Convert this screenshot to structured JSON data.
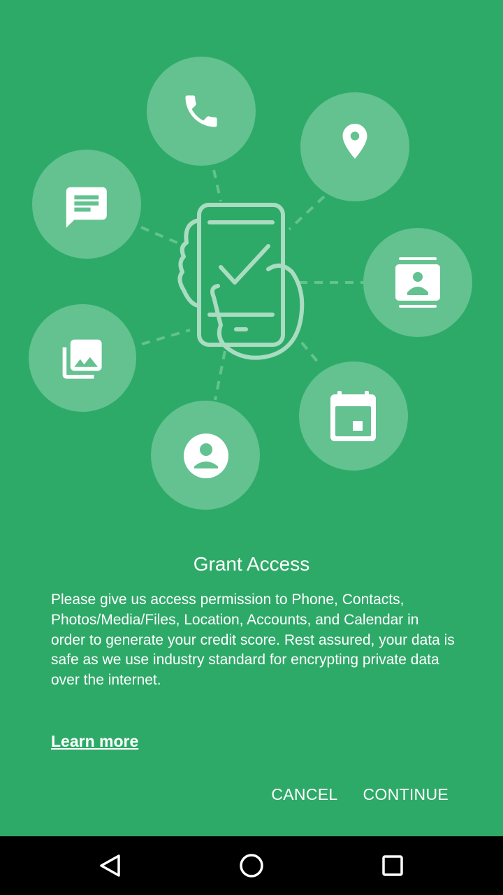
{
  "dialog": {
    "title": "Grant Access",
    "message": "Please give us access permission to Phone, Contacts, Photos/Media/Files, Location, Accounts, and Calendar in order to generate your credit score. Rest assured, your data is safe as we use industry standard for encrypting private data over the internet.",
    "learn_more": "Learn more",
    "cancel_label": "CANCEL",
    "continue_label": "CONTINUE"
  },
  "illustration": {
    "icons": [
      "phone-icon",
      "location-icon",
      "message-icon",
      "account-card-icon",
      "photos-icon",
      "calendar-icon",
      "person-icon",
      "hand-phone-check-icon"
    ]
  },
  "navbar": {
    "buttons": [
      "back-icon",
      "home-icon",
      "recents-icon"
    ]
  },
  "colors": {
    "background": "#2eaa68",
    "circle": "#63c290",
    "text": "#ffffff",
    "navbar": "#000000"
  }
}
